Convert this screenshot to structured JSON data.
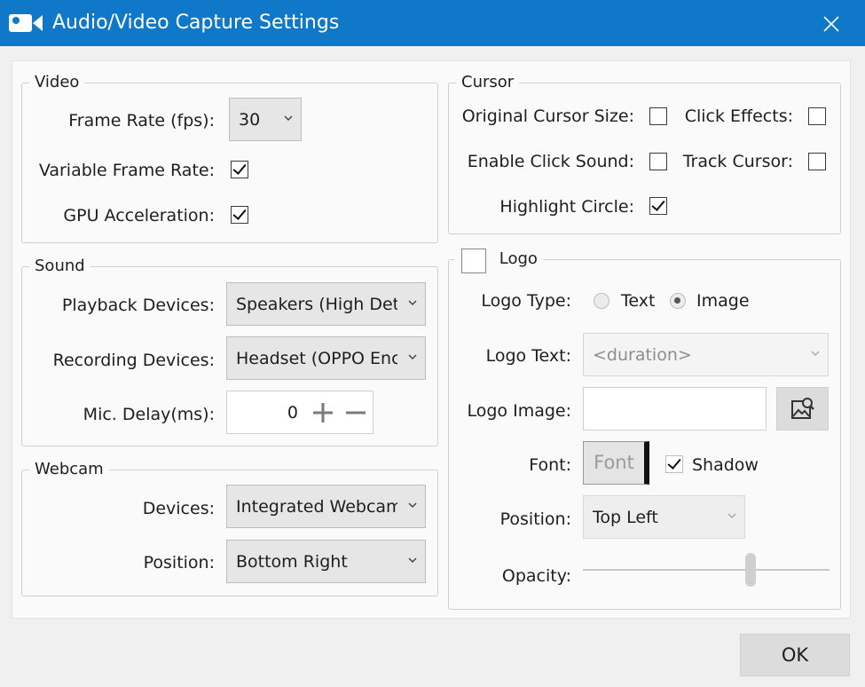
{
  "window": {
    "title": "Audio/Video Capture Settings",
    "icon": "video-camera-icon",
    "title_bar_color": "#0f78c8"
  },
  "video": {
    "legend": "Video",
    "frame_rate_label": "Frame Rate (fps):",
    "frame_rate_value": "30",
    "variable_frame_rate_label": "Variable Frame Rate:",
    "variable_frame_rate_checked": true,
    "gpu_acceleration_label": "GPU Acceleration:",
    "gpu_acceleration_checked": true
  },
  "sound": {
    "legend": "Sound",
    "playback_label": "Playback Devices:",
    "playback_value": "Speakers (High Det",
    "recording_label": "Recording Devices:",
    "recording_value": "Headset (OPPO Enc",
    "mic_delay_label": "Mic. Delay(ms):",
    "mic_delay_value": "0"
  },
  "webcam": {
    "legend": "Webcam",
    "devices_label": "Devices:",
    "devices_value": "Integrated Webcam",
    "position_label": "Position:",
    "position_value": "Bottom Right"
  },
  "cursor": {
    "legend": "Cursor",
    "original_size_label": "Original Cursor Size:",
    "original_size_checked": false,
    "click_effects_label": "Click Effects:",
    "click_effects_checked": false,
    "click_sound_label": "Enable Click Sound:",
    "click_sound_checked": false,
    "track_cursor_label": "Track Cursor:",
    "track_cursor_checked": false,
    "highlight_circle_label": "Highlight Circle:",
    "highlight_circle_checked": true
  },
  "logo": {
    "legend": "Logo",
    "enabled": false,
    "type_label": "Logo Type:",
    "type_text_option": "Text",
    "type_image_option": "Image",
    "type_selected": "Image",
    "text_label": "Logo Text:",
    "text_value": "<duration>",
    "image_label": "Logo Image:",
    "image_value": "",
    "browse_icon": "image-search-icon",
    "font_label": "Font:",
    "font_button": "Font",
    "shadow_label": "Shadow",
    "shadow_checked": true,
    "position_label": "Position:",
    "position_value": "Top Left",
    "opacity_label": "Opacity:",
    "opacity_fraction": 0.68
  },
  "footer": {
    "ok_label": "OK"
  }
}
